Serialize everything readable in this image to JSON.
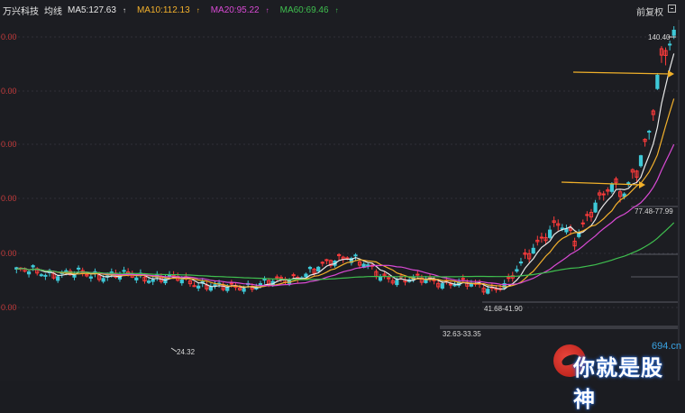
{
  "header": {
    "stock_name": "万兴科技",
    "mode_label": "均线",
    "right_label": "前复权",
    "ma": [
      {
        "label": "MA5:127.63",
        "color": "#e8e8e8"
      },
      {
        "label": "MA10:112.13",
        "color": "#f2b02c"
      },
      {
        "label": "MA20:95.22",
        "color": "#d94ad4"
      },
      {
        "label": "MA60:69.46",
        "color": "#3fbf4f"
      }
    ]
  },
  "y_labels": [
    "0.00",
    "0.00",
    "0.00",
    "0.00",
    "0.00",
    "0.00"
  ],
  "annotations": {
    "high": "140.40",
    "low": "24.32",
    "range1": "32.63-33.35",
    "range2": "41.68-41.90",
    "range3": "77.48-77.99"
  },
  "watermark": {
    "text": "你就是股神",
    "site": "694.cn"
  },
  "colors": {
    "up": "#ff3b3b",
    "down": "#3ec9d8",
    "ma5": "#e8e8e8",
    "ma10": "#f2b02c",
    "ma20": "#d94ad4",
    "ma60": "#3fbf4f",
    "arrow": "#f0b02a"
  },
  "chart_data": {
    "type": "candlestick",
    "series": [
      {
        "name": "MA5",
        "value": 127.63
      },
      {
        "name": "MA10",
        "value": 112.13
      },
      {
        "name": "MA20",
        "value": 95.22
      },
      {
        "name": "MA60",
        "value": 69.46
      }
    ],
    "points_of_interest": [
      {
        "label": "24.32",
        "value": 24.32
      },
      {
        "label": "32.63-33.35",
        "low": 32.63,
        "high": 33.35
      },
      {
        "label": "41.68-41.90",
        "low": 41.68,
        "high": 41.9
      },
      {
        "label": "77.48-77.99",
        "low": 77.48,
        "high": 77.99
      },
      {
        "label": "140.40",
        "value": 140.4
      }
    ]
  }
}
